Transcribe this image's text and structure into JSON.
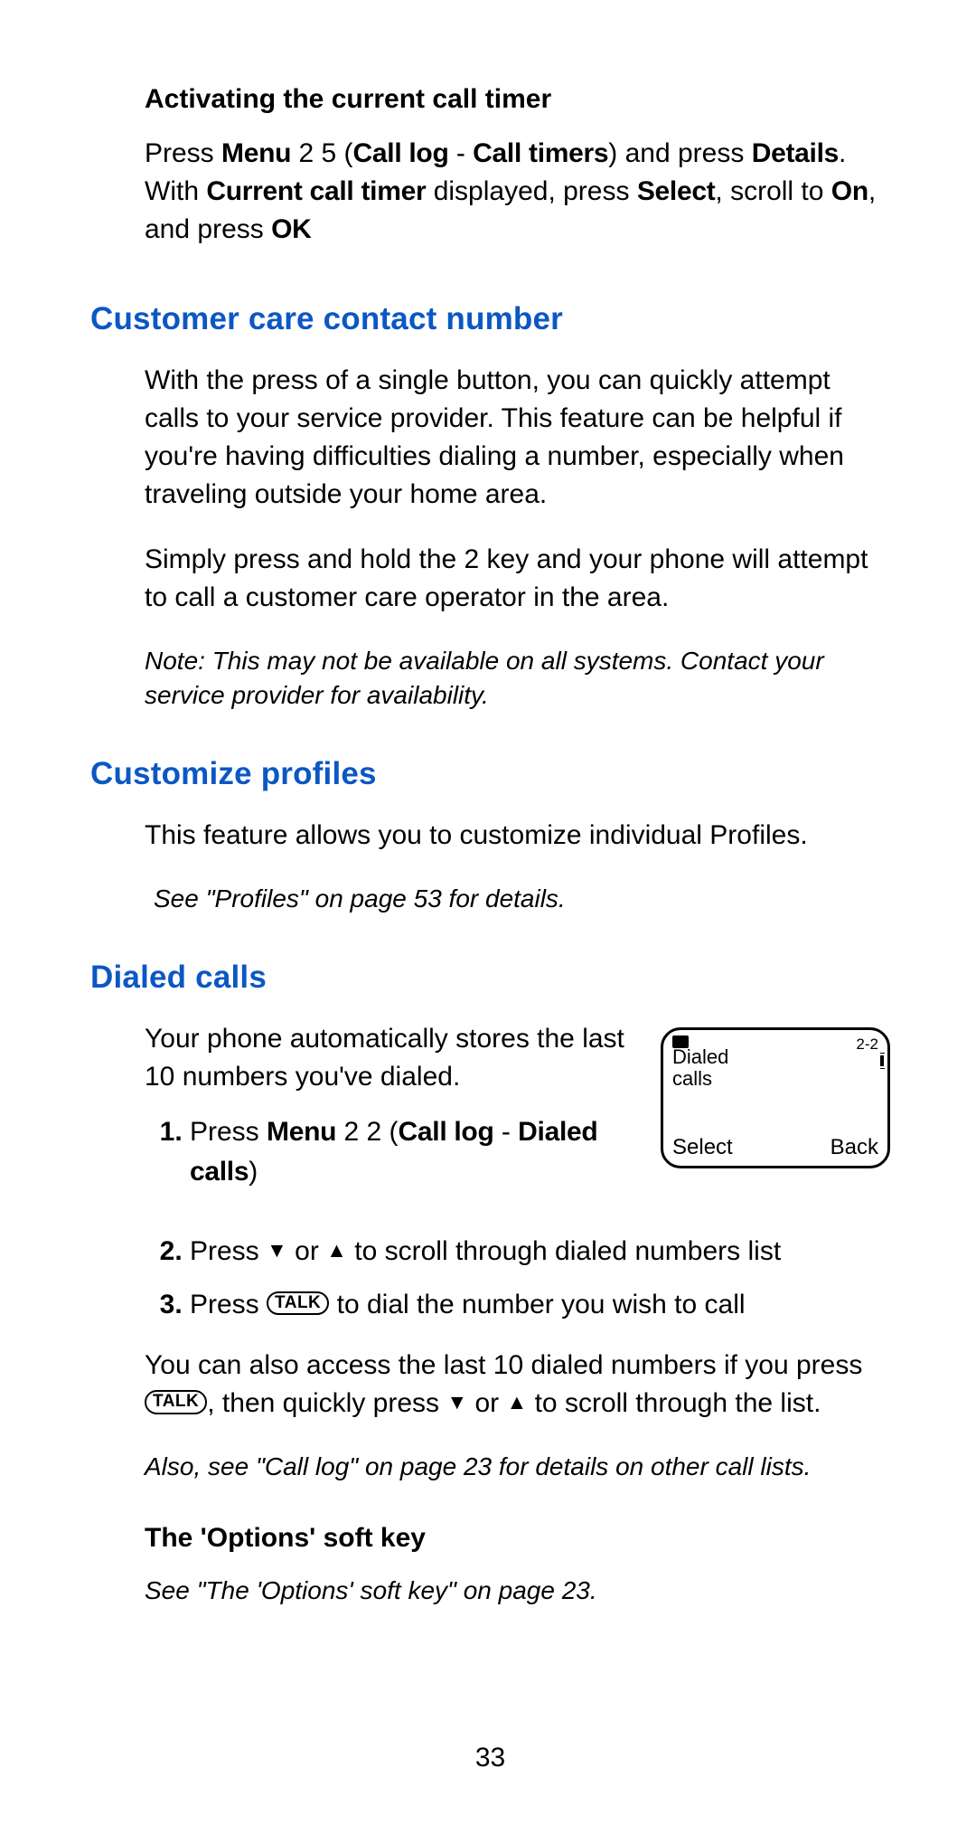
{
  "sub1_heading": "Activating the current call timer",
  "sub1_p_parts": {
    "a": "Press ",
    "menu": "Menu",
    "b": " 2 5 (",
    "calllog": "Call log",
    "dash": " - ",
    "calltimers": "Call timers",
    "c": ") and press ",
    "details": "Details",
    "d": ". With ",
    "currenttimer": "Current call timer",
    "e": " displayed, press ",
    "select": "Select",
    "f": ", scroll to ",
    "on": "On",
    "g": ", and press ",
    "ok": "OK"
  },
  "sec_customer_heading": "Customer care contact number",
  "customer_p1": "With the press of a single button, you can quickly attempt calls to your service provider. This feature can be helpful if you're having difficulties dialing a number, especially when traveling outside your home area.",
  "customer_p2": "Simply press and hold the 2 key and your phone will attempt to call a customer care operator in the area.",
  "customer_note": "Note: This may not be available on all systems. Contact your service provider for availability.",
  "sec_customize_heading": "Customize profiles",
  "customize_p1": "This feature allows you to customize individual Profiles.",
  "customize_note": "See \"Profiles\" on page 53 for details.",
  "sec_dialed_heading": "Dialed calls",
  "dialed_intro": "Your phone automatically stores the last 10 numbers you've dialed.",
  "screen": {
    "title": "Dialed calls",
    "index": "2-2",
    "left": "Select",
    "right": "Back"
  },
  "step1": {
    "a": "Press ",
    "menu": "Menu",
    "b": " 2 2 (",
    "calllog": "Call log",
    "dash": " - ",
    "dialed": "Dialed calls",
    "c": ")"
  },
  "step2": {
    "a": "Press ",
    "down": "▼",
    "or": " or ",
    "up": "▲",
    "b": " to scroll through dialed numbers list"
  },
  "step3": {
    "a": "Press ",
    "talk": "TALK",
    "b": " to dial the number you wish to call"
  },
  "dialed_para2": {
    "a": "You can also access the last 10 dialed numbers if you press ",
    "talk": "TALK",
    "b": ", then quickly press ",
    "down": "▼",
    "or": " or ",
    "up": "▲",
    "c": " to scroll through the list."
  },
  "dialed_note": "Also, see \"Call log\" on page 23 for details on other call lists.",
  "options_heading": "The 'Options' soft key",
  "options_note": "See \"The 'Options' soft key\" on page 23.",
  "page_number": "33"
}
